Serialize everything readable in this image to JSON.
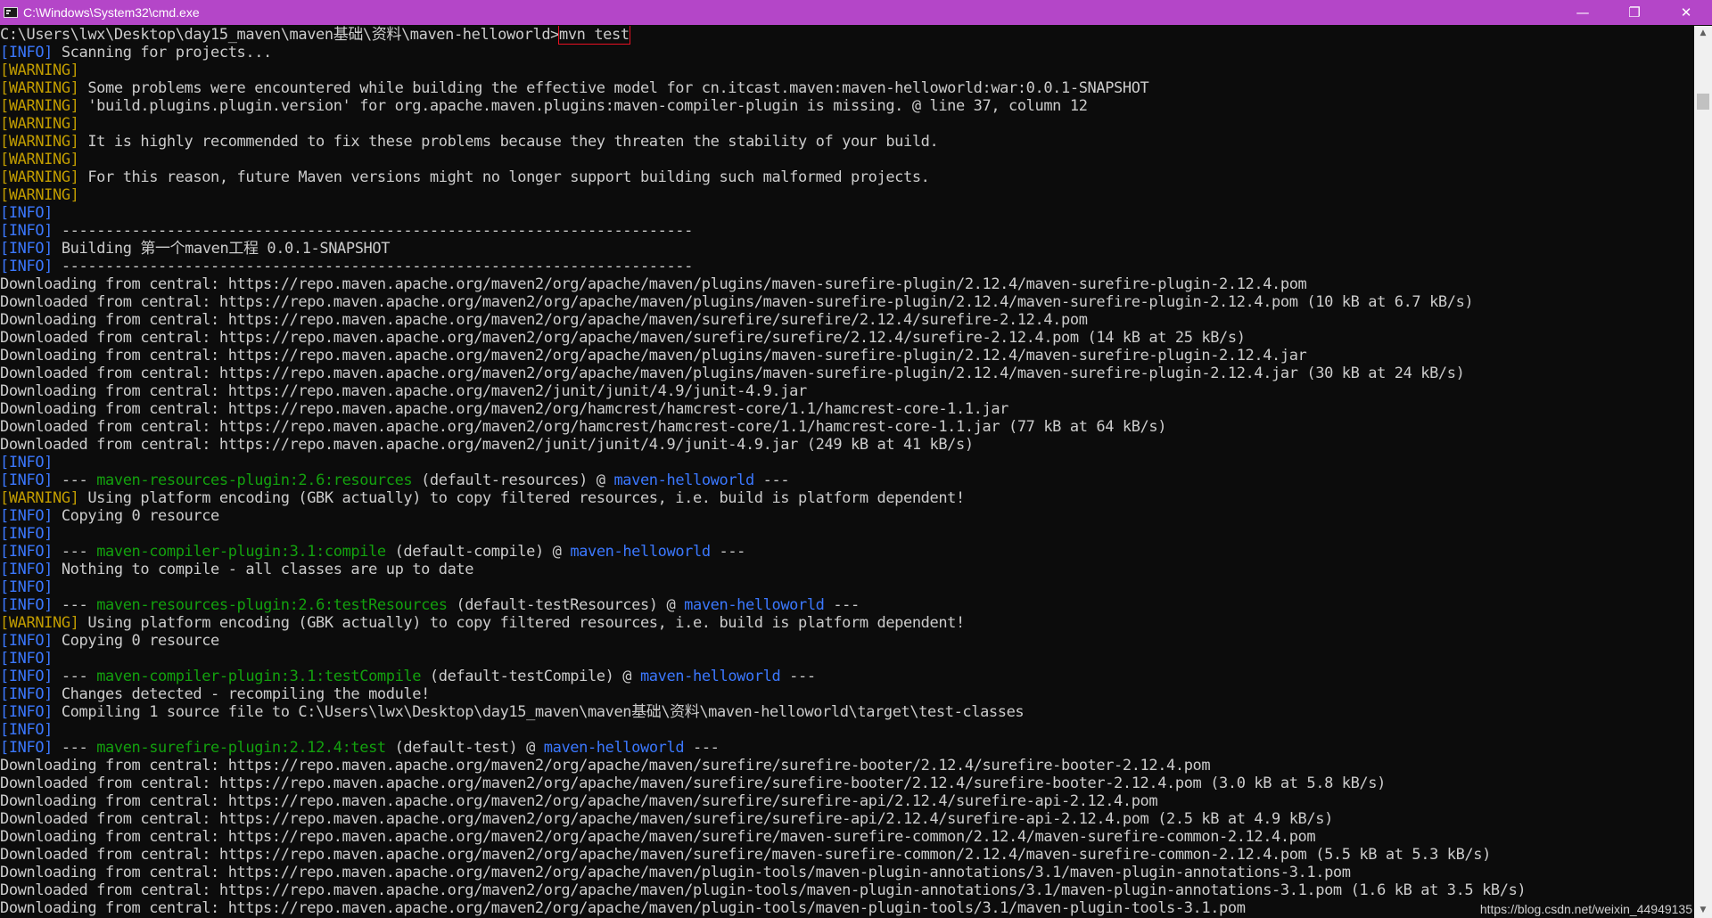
{
  "window": {
    "title": "C:\\Windows\\System32\\cmd.exe",
    "icon": "cmd-icon",
    "minimize": "—",
    "restore": "❐",
    "close": "✕"
  },
  "colors": {
    "titlebar": "#b446c8",
    "background": "#0c0c0c",
    "text": "#cccccc",
    "info": "#3b78ff",
    "warning": "#c19c00",
    "plugin": "#13a10e",
    "highlight": "#e81123"
  },
  "prompt": {
    "path": "C:\\Users\\lwx\\Desktop\\day15_maven\\maven基础\\资料\\maven-helloworld>",
    "command": "mvn test"
  },
  "lines": [
    [
      [
        "info",
        "[INFO]"
      ],
      [
        "text",
        " Scanning for projects..."
      ]
    ],
    [
      [
        "warn",
        "[WARNING]"
      ]
    ],
    [
      [
        "warn",
        "[WARNING]"
      ],
      [
        "text",
        " Some problems were encountered while building the effective model for cn.itcast.maven:maven-helloworld:war:0.0.1-SNAPSHOT"
      ]
    ],
    [
      [
        "warn",
        "[WARNING]"
      ],
      [
        "text",
        " 'build.plugins.plugin.version' for org.apache.maven.plugins:maven-compiler-plugin is missing. @ line 37, column 12"
      ]
    ],
    [
      [
        "warn",
        "[WARNING]"
      ]
    ],
    [
      [
        "warn",
        "[WARNING]"
      ],
      [
        "text",
        " It is highly recommended to fix these problems because they threaten the stability of your build."
      ]
    ],
    [
      [
        "warn",
        "[WARNING]"
      ]
    ],
    [
      [
        "warn",
        "[WARNING]"
      ],
      [
        "text",
        " For this reason, future Maven versions might no longer support building such malformed projects."
      ]
    ],
    [
      [
        "warn",
        "[WARNING]"
      ]
    ],
    [
      [
        "info",
        "[INFO]"
      ]
    ],
    [
      [
        "info",
        "[INFO]"
      ],
      [
        "text",
        " ------------------------------------------------------------------------"
      ]
    ],
    [
      [
        "info",
        "[INFO]"
      ],
      [
        "text",
        " Building 第一个maven工程 0.0.1-SNAPSHOT"
      ]
    ],
    [
      [
        "info",
        "[INFO]"
      ],
      [
        "text",
        " ------------------------------------------------------------------------"
      ]
    ],
    [
      [
        "text",
        "Downloading from central: https://repo.maven.apache.org/maven2/org/apache/maven/plugins/maven-surefire-plugin/2.12.4/maven-surefire-plugin-2.12.4.pom"
      ]
    ],
    [
      [
        "text",
        "Downloaded from central: https://repo.maven.apache.org/maven2/org/apache/maven/plugins/maven-surefire-plugin/2.12.4/maven-surefire-plugin-2.12.4.pom (10 kB at 6.7 kB/s)"
      ]
    ],
    [
      [
        "text",
        "Downloading from central: https://repo.maven.apache.org/maven2/org/apache/maven/surefire/surefire/2.12.4/surefire-2.12.4.pom"
      ]
    ],
    [
      [
        "text",
        "Downloaded from central: https://repo.maven.apache.org/maven2/org/apache/maven/surefire/surefire/2.12.4/surefire-2.12.4.pom (14 kB at 25 kB/s)"
      ]
    ],
    [
      [
        "text",
        "Downloading from central: https://repo.maven.apache.org/maven2/org/apache/maven/plugins/maven-surefire-plugin/2.12.4/maven-surefire-plugin-2.12.4.jar"
      ]
    ],
    [
      [
        "text",
        "Downloaded from central: https://repo.maven.apache.org/maven2/org/apache/maven/plugins/maven-surefire-plugin/2.12.4/maven-surefire-plugin-2.12.4.jar (30 kB at 24 kB/s)"
      ]
    ],
    [
      [
        "text",
        "Downloading from central: https://repo.maven.apache.org/maven2/junit/junit/4.9/junit-4.9.jar"
      ]
    ],
    [
      [
        "text",
        "Downloading from central: https://repo.maven.apache.org/maven2/org/hamcrest/hamcrest-core/1.1/hamcrest-core-1.1.jar"
      ]
    ],
    [
      [
        "text",
        "Downloaded from central: https://repo.maven.apache.org/maven2/org/hamcrest/hamcrest-core/1.1/hamcrest-core-1.1.jar (77 kB at 64 kB/s)"
      ]
    ],
    [
      [
        "text",
        "Downloaded from central: https://repo.maven.apache.org/maven2/junit/junit/4.9/junit-4.9.jar (249 kB at 41 kB/s)"
      ]
    ],
    [
      [
        "info",
        "[INFO]"
      ]
    ],
    [
      [
        "info",
        "[INFO]"
      ],
      [
        "text",
        " --- "
      ],
      [
        "green",
        "maven-resources-plugin:2.6:resources"
      ],
      [
        "text",
        " (default-resources) @ "
      ],
      [
        "blue",
        "maven-helloworld"
      ],
      [
        "text",
        " ---"
      ]
    ],
    [
      [
        "warn",
        "[WARNING]"
      ],
      [
        "text",
        " Using platform encoding (GBK actually) to copy filtered resources, i.e. build is platform dependent!"
      ]
    ],
    [
      [
        "info",
        "[INFO]"
      ],
      [
        "text",
        " Copying 0 resource"
      ]
    ],
    [
      [
        "info",
        "[INFO]"
      ]
    ],
    [
      [
        "info",
        "[INFO]"
      ],
      [
        "text",
        " --- "
      ],
      [
        "green",
        "maven-compiler-plugin:3.1:compile"
      ],
      [
        "text",
        " (default-compile) @ "
      ],
      [
        "blue",
        "maven-helloworld"
      ],
      [
        "text",
        " ---"
      ]
    ],
    [
      [
        "info",
        "[INFO]"
      ],
      [
        "text",
        " Nothing to compile - all classes are up to date"
      ]
    ],
    [
      [
        "info",
        "[INFO]"
      ]
    ],
    [
      [
        "info",
        "[INFO]"
      ],
      [
        "text",
        " --- "
      ],
      [
        "green",
        "maven-resources-plugin:2.6:testResources"
      ],
      [
        "text",
        " (default-testResources) @ "
      ],
      [
        "blue",
        "maven-helloworld"
      ],
      [
        "text",
        " ---"
      ]
    ],
    [
      [
        "warn",
        "[WARNING]"
      ],
      [
        "text",
        " Using platform encoding (GBK actually) to copy filtered resources, i.e. build is platform dependent!"
      ]
    ],
    [
      [
        "info",
        "[INFO]"
      ],
      [
        "text",
        " Copying 0 resource"
      ]
    ],
    [
      [
        "info",
        "[INFO]"
      ]
    ],
    [
      [
        "info",
        "[INFO]"
      ],
      [
        "text",
        " --- "
      ],
      [
        "green",
        "maven-compiler-plugin:3.1:testCompile"
      ],
      [
        "text",
        " (default-testCompile) @ "
      ],
      [
        "blue",
        "maven-helloworld"
      ],
      [
        "text",
        " ---"
      ]
    ],
    [
      [
        "info",
        "[INFO]"
      ],
      [
        "text",
        " Changes detected - recompiling the module!"
      ]
    ],
    [
      [
        "info",
        "[INFO]"
      ],
      [
        "text",
        " Compiling 1 source file to C:\\Users\\lwx\\Desktop\\day15_maven\\maven基础\\资料\\maven-helloworld\\target\\test-classes"
      ]
    ],
    [
      [
        "info",
        "[INFO]"
      ]
    ],
    [
      [
        "info",
        "[INFO]"
      ],
      [
        "text",
        " --- "
      ],
      [
        "green",
        "maven-surefire-plugin:2.12.4:test"
      ],
      [
        "text",
        " (default-test) @ "
      ],
      [
        "blue",
        "maven-helloworld"
      ],
      [
        "text",
        " ---"
      ]
    ],
    [
      [
        "text",
        "Downloading from central: https://repo.maven.apache.org/maven2/org/apache/maven/surefire/surefire-booter/2.12.4/surefire-booter-2.12.4.pom"
      ]
    ],
    [
      [
        "text",
        "Downloaded from central: https://repo.maven.apache.org/maven2/org/apache/maven/surefire/surefire-booter/2.12.4/surefire-booter-2.12.4.pom (3.0 kB at 5.8 kB/s)"
      ]
    ],
    [
      [
        "text",
        "Downloading from central: https://repo.maven.apache.org/maven2/org/apache/maven/surefire/surefire-api/2.12.4/surefire-api-2.12.4.pom"
      ]
    ],
    [
      [
        "text",
        "Downloaded from central: https://repo.maven.apache.org/maven2/org/apache/maven/surefire/surefire-api/2.12.4/surefire-api-2.12.4.pom (2.5 kB at 4.9 kB/s)"
      ]
    ],
    [
      [
        "text",
        "Downloading from central: https://repo.maven.apache.org/maven2/org/apache/maven/surefire/maven-surefire-common/2.12.4/maven-surefire-common-2.12.4.pom"
      ]
    ],
    [
      [
        "text",
        "Downloaded from central: https://repo.maven.apache.org/maven2/org/apache/maven/surefire/maven-surefire-common/2.12.4/maven-surefire-common-2.12.4.pom (5.5 kB at 5.3 kB/s)"
      ]
    ],
    [
      [
        "text",
        "Downloading from central: https://repo.maven.apache.org/maven2/org/apache/maven/plugin-tools/maven-plugin-annotations/3.1/maven-plugin-annotations-3.1.pom"
      ]
    ],
    [
      [
        "text",
        "Downloaded from central: https://repo.maven.apache.org/maven2/org/apache/maven/plugin-tools/maven-plugin-annotations/3.1/maven-plugin-annotations-3.1.pom (1.6 kB at 3.5 kB/s)"
      ]
    ],
    [
      [
        "text",
        "Downloading from central: https://repo.maven.apache.org/maven2/org/apache/maven/plugin-tools/maven-plugin-tools/3.1/maven-plugin-tools-3.1.pom"
      ]
    ]
  ],
  "scrollbar": {
    "up": "▲",
    "down": "▼"
  },
  "watermark": "https://blog.csdn.net/weixin_44949135"
}
